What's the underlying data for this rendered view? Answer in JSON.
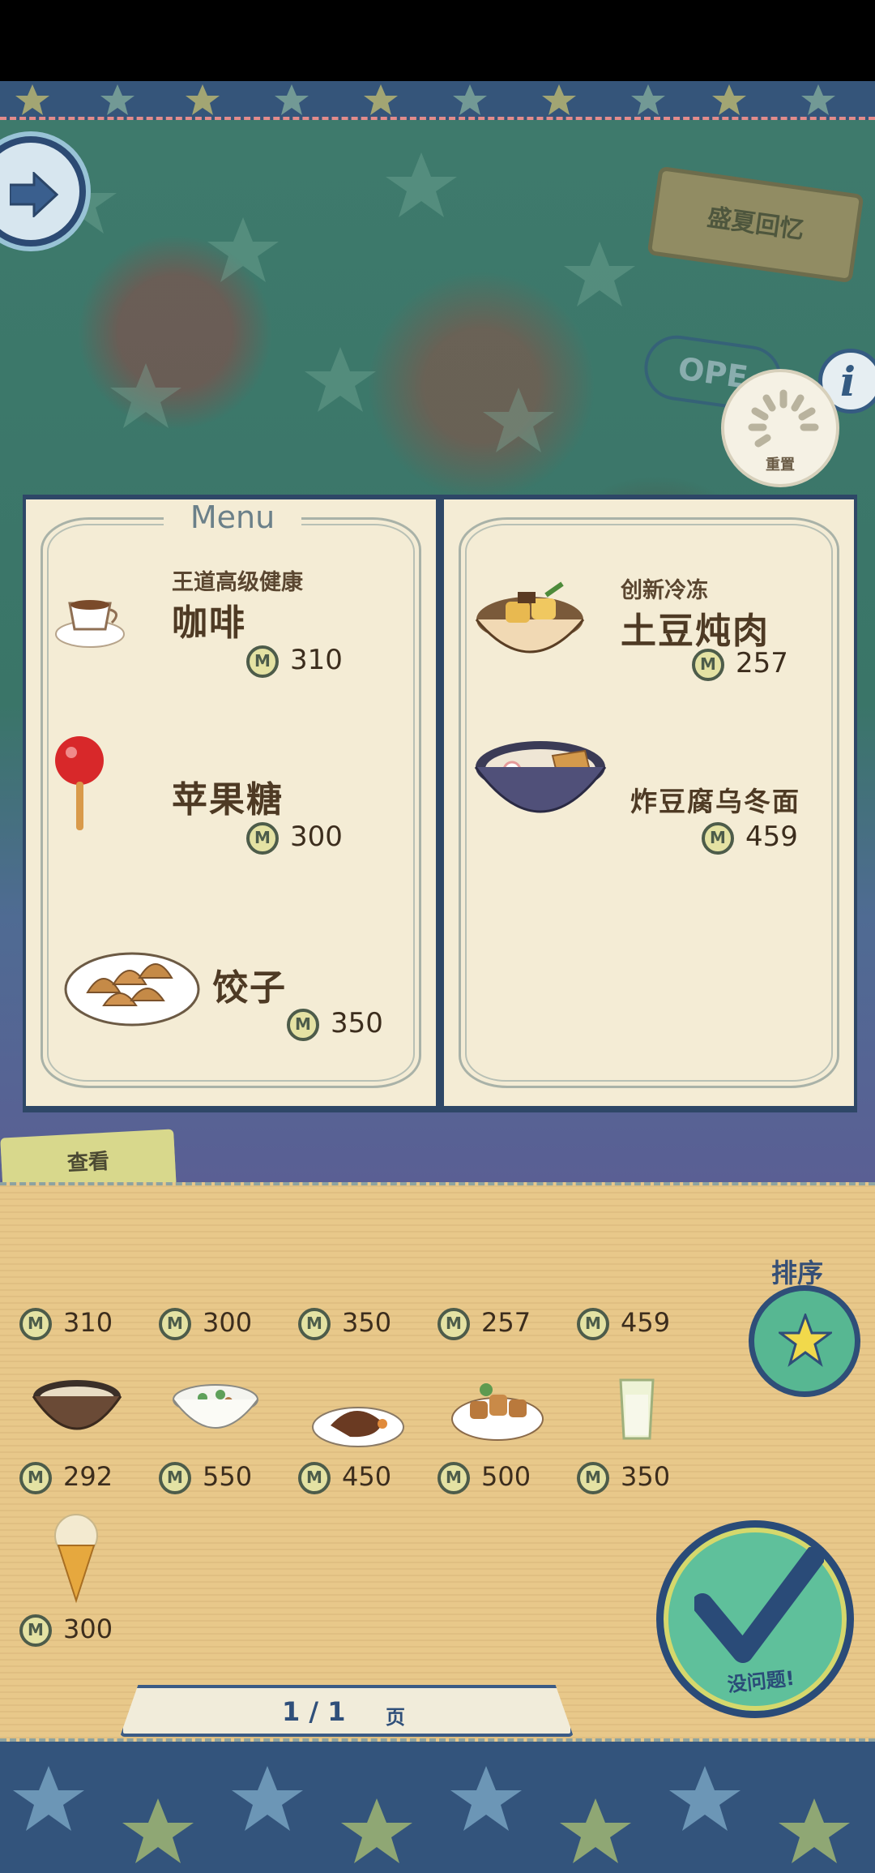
{
  "header": {
    "signboard_text": "盛夏回忆",
    "open_sign_text": "OPE"
  },
  "reset": {
    "label": "重置"
  },
  "info": {
    "label": "i"
  },
  "menu": {
    "title": "Menu",
    "left_page": [
      {
        "sub": "王道高级健康",
        "name": "咖啡",
        "price": "310",
        "icon": "coffee-cup-icon"
      },
      {
        "sub": "",
        "name": "苹果糖",
        "price": "300",
        "icon": "candy-apple-icon"
      },
      {
        "sub": "",
        "name": "饺子",
        "price": "350",
        "icon": "dumplings-icon"
      }
    ],
    "right_page": [
      {
        "sub": "创新冷冻",
        "name": "土豆炖肉",
        "price": "257",
        "icon": "nikujaga-bowl-icon"
      },
      {
        "sub": "",
        "name": "炸豆腐乌冬面",
        "price": "459",
        "icon": "kitsune-udon-icon"
      }
    ]
  },
  "view_tab": {
    "label": "查看"
  },
  "tray": {
    "row1_prices": [
      "310",
      "300",
      "350",
      "257",
      "459"
    ],
    "row2_prices": [
      "292",
      "550",
      "450",
      "500",
      "350"
    ],
    "row3_prices": [
      "300"
    ],
    "row2_icons": [
      "udon-bowl-icon",
      "rice-porridge-icon",
      "steak-plate-icon",
      "yakitori-plate-icon",
      "milk-glass-icon"
    ],
    "row3_icons": [
      "ice-cream-cone-icon"
    ]
  },
  "sort": {
    "label": "排序"
  },
  "confirm": {
    "label": "没问题!"
  },
  "pager": {
    "count": "1 / 1",
    "unit": "页"
  },
  "coin_glyph": "M",
  "colors": {
    "navy": "#2e4767",
    "paper": "#f4ecd5",
    "tray": "#e8c88a",
    "accent_green": "#5fc09b"
  }
}
